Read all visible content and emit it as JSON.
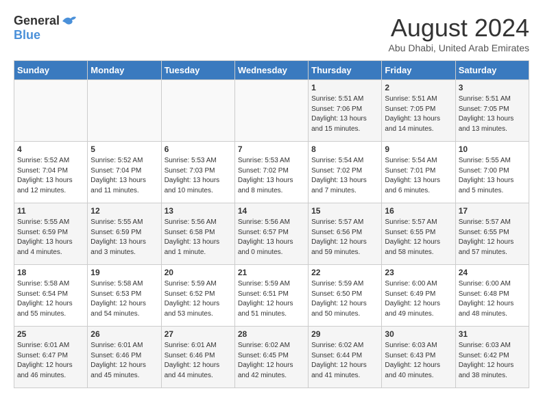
{
  "header": {
    "logo_general": "General",
    "logo_blue": "Blue",
    "title": "August 2024",
    "subtitle": "Abu Dhabi, United Arab Emirates"
  },
  "days_of_week": [
    "Sunday",
    "Monday",
    "Tuesday",
    "Wednesday",
    "Thursday",
    "Friday",
    "Saturday"
  ],
  "weeks": [
    [
      {
        "day": "",
        "info": ""
      },
      {
        "day": "",
        "info": ""
      },
      {
        "day": "",
        "info": ""
      },
      {
        "day": "",
        "info": ""
      },
      {
        "day": "1",
        "info": "Sunrise: 5:51 AM\nSunset: 7:06 PM\nDaylight: 13 hours\nand 15 minutes."
      },
      {
        "day": "2",
        "info": "Sunrise: 5:51 AM\nSunset: 7:05 PM\nDaylight: 13 hours\nand 14 minutes."
      },
      {
        "day": "3",
        "info": "Sunrise: 5:51 AM\nSunset: 7:05 PM\nDaylight: 13 hours\nand 13 minutes."
      }
    ],
    [
      {
        "day": "4",
        "info": "Sunrise: 5:52 AM\nSunset: 7:04 PM\nDaylight: 13 hours\nand 12 minutes."
      },
      {
        "day": "5",
        "info": "Sunrise: 5:52 AM\nSunset: 7:04 PM\nDaylight: 13 hours\nand 11 minutes."
      },
      {
        "day": "6",
        "info": "Sunrise: 5:53 AM\nSunset: 7:03 PM\nDaylight: 13 hours\nand 10 minutes."
      },
      {
        "day": "7",
        "info": "Sunrise: 5:53 AM\nSunset: 7:02 PM\nDaylight: 13 hours\nand 8 minutes."
      },
      {
        "day": "8",
        "info": "Sunrise: 5:54 AM\nSunset: 7:02 PM\nDaylight: 13 hours\nand 7 minutes."
      },
      {
        "day": "9",
        "info": "Sunrise: 5:54 AM\nSunset: 7:01 PM\nDaylight: 13 hours\nand 6 minutes."
      },
      {
        "day": "10",
        "info": "Sunrise: 5:55 AM\nSunset: 7:00 PM\nDaylight: 13 hours\nand 5 minutes."
      }
    ],
    [
      {
        "day": "11",
        "info": "Sunrise: 5:55 AM\nSunset: 6:59 PM\nDaylight: 13 hours\nand 4 minutes."
      },
      {
        "day": "12",
        "info": "Sunrise: 5:55 AM\nSunset: 6:59 PM\nDaylight: 13 hours\nand 3 minutes."
      },
      {
        "day": "13",
        "info": "Sunrise: 5:56 AM\nSunset: 6:58 PM\nDaylight: 13 hours\nand 1 minute."
      },
      {
        "day": "14",
        "info": "Sunrise: 5:56 AM\nSunset: 6:57 PM\nDaylight: 13 hours\nand 0 minutes."
      },
      {
        "day": "15",
        "info": "Sunrise: 5:57 AM\nSunset: 6:56 PM\nDaylight: 12 hours\nand 59 minutes."
      },
      {
        "day": "16",
        "info": "Sunrise: 5:57 AM\nSunset: 6:55 PM\nDaylight: 12 hours\nand 58 minutes."
      },
      {
        "day": "17",
        "info": "Sunrise: 5:57 AM\nSunset: 6:55 PM\nDaylight: 12 hours\nand 57 minutes."
      }
    ],
    [
      {
        "day": "18",
        "info": "Sunrise: 5:58 AM\nSunset: 6:54 PM\nDaylight: 12 hours\nand 55 minutes."
      },
      {
        "day": "19",
        "info": "Sunrise: 5:58 AM\nSunset: 6:53 PM\nDaylight: 12 hours\nand 54 minutes."
      },
      {
        "day": "20",
        "info": "Sunrise: 5:59 AM\nSunset: 6:52 PM\nDaylight: 12 hours\nand 53 minutes."
      },
      {
        "day": "21",
        "info": "Sunrise: 5:59 AM\nSunset: 6:51 PM\nDaylight: 12 hours\nand 51 minutes."
      },
      {
        "day": "22",
        "info": "Sunrise: 5:59 AM\nSunset: 6:50 PM\nDaylight: 12 hours\nand 50 minutes."
      },
      {
        "day": "23",
        "info": "Sunrise: 6:00 AM\nSunset: 6:49 PM\nDaylight: 12 hours\nand 49 minutes."
      },
      {
        "day": "24",
        "info": "Sunrise: 6:00 AM\nSunset: 6:48 PM\nDaylight: 12 hours\nand 48 minutes."
      }
    ],
    [
      {
        "day": "25",
        "info": "Sunrise: 6:01 AM\nSunset: 6:47 PM\nDaylight: 12 hours\nand 46 minutes."
      },
      {
        "day": "26",
        "info": "Sunrise: 6:01 AM\nSunset: 6:46 PM\nDaylight: 12 hours\nand 45 minutes."
      },
      {
        "day": "27",
        "info": "Sunrise: 6:01 AM\nSunset: 6:46 PM\nDaylight: 12 hours\nand 44 minutes."
      },
      {
        "day": "28",
        "info": "Sunrise: 6:02 AM\nSunset: 6:45 PM\nDaylight: 12 hours\nand 42 minutes."
      },
      {
        "day": "29",
        "info": "Sunrise: 6:02 AM\nSunset: 6:44 PM\nDaylight: 12 hours\nand 41 minutes."
      },
      {
        "day": "30",
        "info": "Sunrise: 6:03 AM\nSunset: 6:43 PM\nDaylight: 12 hours\nand 40 minutes."
      },
      {
        "day": "31",
        "info": "Sunrise: 6:03 AM\nSunset: 6:42 PM\nDaylight: 12 hours\nand 38 minutes."
      }
    ]
  ]
}
